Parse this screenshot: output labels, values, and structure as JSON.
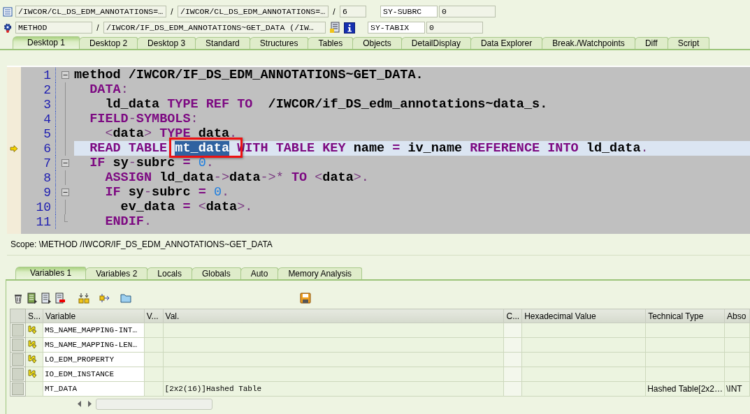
{
  "header": {
    "rows": [
      {
        "fields": [
          {
            "value": "/IWCOR/CL_DS_EDM_ANNOTATIONS=…",
            "kind": "wide"
          },
          {
            "value": "/IWCOR/CL_DS_EDM_ANNOTATIONS=…",
            "kind": "wide"
          },
          {
            "value": "6",
            "kind": "short"
          }
        ],
        "separators": [
          "/",
          "/"
        ],
        "sysvar": "SY-SUBRC",
        "sysvalue": "0"
      },
      {
        "fields": [
          {
            "value": "METHOD",
            "kind": "mid"
          },
          {
            "value": "/IWCOR/IF_DS_EDM_ANNOTATIONS~GET_DATA (/IW…",
            "kind": "long"
          }
        ],
        "separators": [
          "/"
        ],
        "sysvar": "SY-TABIX",
        "sysvalue": "0"
      }
    ]
  },
  "tabs": [
    {
      "label": "Desktop 1",
      "selected": true
    },
    {
      "label": "Desktop 2",
      "selected": false
    },
    {
      "label": "Desktop 3",
      "selected": false
    },
    {
      "label": "Standard",
      "selected": false
    },
    {
      "label": "Structures",
      "selected": false
    },
    {
      "label": "Tables",
      "selected": false
    },
    {
      "label": "Objects",
      "selected": false
    },
    {
      "label": "DetailDisplay",
      "selected": false
    },
    {
      "label": "Data Explorer",
      "selected": false
    },
    {
      "label": "Break./Watchpoints",
      "selected": false
    },
    {
      "label": "Diff",
      "selected": false
    },
    {
      "label": "Script",
      "selected": false
    }
  ],
  "code": {
    "lines": [
      {
        "number": "1",
        "kind": "start",
        "current": false,
        "tokens": [
          {
            "kind": "id",
            "text": "method /IWCOR/IF_DS_EDM_ANNOTATIONS~GET_DATA."
          }
        ]
      },
      {
        "number": "2",
        "kind": "cont",
        "current": false,
        "tokens": [
          {
            "kind": "kw",
            "text": "  DATA"
          },
          {
            "kind": "op",
            "text": ":"
          }
        ]
      },
      {
        "number": "3",
        "kind": "cont",
        "current": false,
        "tokens": [
          {
            "kind": "id",
            "text": "    ld_data "
          },
          {
            "kind": "kw",
            "text": "TYPE REF TO"
          },
          {
            "kind": "id",
            "text": "  /IWCOR/if_DS_edm_annotations~data_s."
          }
        ]
      },
      {
        "number": "4",
        "kind": "cont",
        "current": false,
        "tokens": [
          {
            "kind": "kw",
            "text": "  FIELD"
          },
          {
            "kind": "op",
            "text": "-"
          },
          {
            "kind": "kw",
            "text": "SYMBOLS"
          },
          {
            "kind": "op",
            "text": ":"
          }
        ]
      },
      {
        "number": "5",
        "kind": "cont",
        "current": false,
        "tokens": [
          {
            "kind": "op",
            "text": "    <"
          },
          {
            "kind": "id",
            "text": "data"
          },
          {
            "kind": "op",
            "text": "> "
          },
          {
            "kind": "kw",
            "text": "TYPE"
          },
          {
            "kind": "id",
            "text": " data"
          },
          {
            "kind": "op",
            "text": "."
          }
        ]
      },
      {
        "number": "6",
        "kind": "cont",
        "current": true,
        "tokens": [
          {
            "kind": "kw",
            "text": "  READ TABLE "
          },
          {
            "kind": "sel",
            "text": "mt_data"
          },
          {
            "kind": "kw",
            "text": " WITH TABLE KEY"
          },
          {
            "kind": "id",
            "text": " name "
          },
          {
            "kind": "kw",
            "text": "="
          },
          {
            "kind": "id",
            "text": " iv_name "
          },
          {
            "kind": "kw",
            "text": "REFERENCE INTO"
          },
          {
            "kind": "id",
            "text": " ld_data"
          },
          {
            "kind": "op",
            "text": "."
          }
        ]
      },
      {
        "number": "7",
        "kind": "start",
        "current": false,
        "tokens": [
          {
            "kind": "kw",
            "text": "  IF"
          },
          {
            "kind": "id",
            "text": " sy"
          },
          {
            "kind": "op",
            "text": "-"
          },
          {
            "kind": "id",
            "text": "subrc "
          },
          {
            "kind": "kw",
            "text": "="
          },
          {
            "kind": "num",
            "text": " 0"
          },
          {
            "kind": "op",
            "text": "."
          }
        ]
      },
      {
        "number": "8",
        "kind": "cont",
        "current": false,
        "tokens": [
          {
            "kind": "kw",
            "text": "    ASSIGN"
          },
          {
            "kind": "id",
            "text": " ld_data"
          },
          {
            "kind": "op",
            "text": "->"
          },
          {
            "kind": "id",
            "text": "data"
          },
          {
            "kind": "op",
            "text": "->*"
          },
          {
            "kind": "kw",
            "text": " TO"
          },
          {
            "kind": "op",
            "text": " <"
          },
          {
            "kind": "id",
            "text": "data"
          },
          {
            "kind": "op",
            "text": ">."
          }
        ]
      },
      {
        "number": "9",
        "kind": "start",
        "current": false,
        "tokens": [
          {
            "kind": "kw",
            "text": "    IF"
          },
          {
            "kind": "id",
            "text": " sy"
          },
          {
            "kind": "op",
            "text": "-"
          },
          {
            "kind": "id",
            "text": "subrc "
          },
          {
            "kind": "kw",
            "text": "="
          },
          {
            "kind": "num",
            "text": " 0"
          },
          {
            "kind": "op",
            "text": "."
          }
        ]
      },
      {
        "number": "10",
        "kind": "cont",
        "current": false,
        "tokens": [
          {
            "kind": "id",
            "text": "      ev_data "
          },
          {
            "kind": "kw",
            "text": "="
          },
          {
            "kind": "op",
            "text": " <"
          },
          {
            "kind": "id",
            "text": "data"
          },
          {
            "kind": "op",
            "text": ">."
          }
        ]
      },
      {
        "number": "11",
        "kind": "end",
        "current": false,
        "tokens": [
          {
            "kind": "kw",
            "text": "    ENDIF"
          },
          {
            "kind": "op",
            "text": "."
          }
        ]
      }
    ]
  },
  "scope": "Scope: \\METHOD /IWCOR/IF_DS_EDM_ANNOTATIONS~GET_DATA",
  "lower_tabs": [
    {
      "label": "Variables 1",
      "selected": true
    },
    {
      "label": "Variables 2",
      "selected": false
    },
    {
      "label": "Locals",
      "selected": false
    },
    {
      "label": "Globals",
      "selected": false
    },
    {
      "label": "Auto",
      "selected": false
    },
    {
      "label": "Memory Analysis",
      "selected": false
    }
  ],
  "table": {
    "columns": [
      "S...",
      "Variable",
      "V...",
      "Val.",
      "C...",
      "Hexadecimal Value",
      "Technical Type",
      "Abso"
    ],
    "rows": [
      {
        "marked": true,
        "variable": "MS_NAME_MAPPING-INT…"
      },
      {
        "marked": true,
        "variable": "MS_NAME_MAPPING-LEN…"
      },
      {
        "marked": true,
        "variable": "LO_EDM_PROPERTY"
      },
      {
        "marked": true,
        "variable": "IO_EDM_INSTANCE"
      },
      {
        "marked": false,
        "variable": "MT_DATA",
        "value": "[2x2(16)]Hashed Table",
        "technical_type": "Hashed Table[2x2…",
        "column_8": "\\INT"
      }
    ]
  }
}
